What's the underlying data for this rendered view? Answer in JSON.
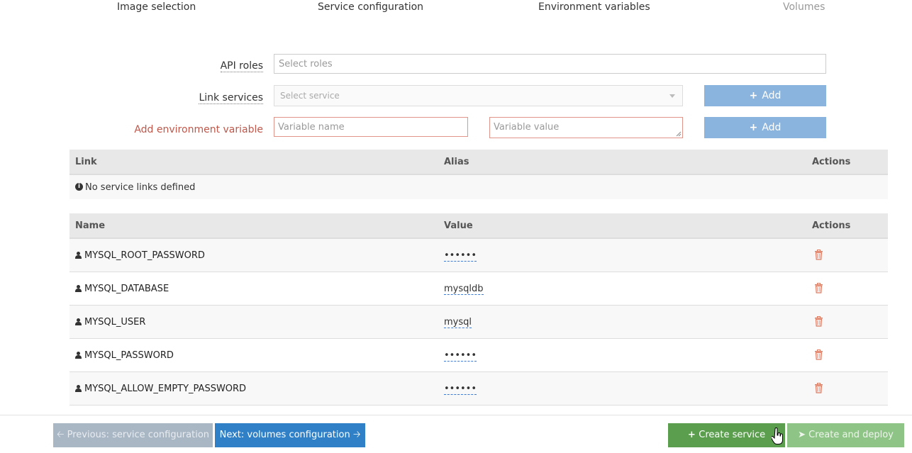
{
  "steps": [
    {
      "label": "Image selection"
    },
    {
      "label": "Service configuration"
    },
    {
      "label": "Environment variables"
    },
    {
      "label": "Volumes"
    }
  ],
  "form": {
    "api_roles_label": "API roles",
    "api_roles_placeholder": "Select roles",
    "link_services_label": "Link services",
    "link_services_placeholder": "Select service",
    "link_add_label": "Add",
    "env_label": "Add environment variable",
    "env_name_placeholder": "Variable name",
    "env_value_placeholder": "Variable value",
    "env_add_label": "Add"
  },
  "links_table": {
    "headers": {
      "link": "Link",
      "alias": "Alias",
      "actions": "Actions"
    },
    "empty_message": "No service links defined"
  },
  "env_table": {
    "headers": {
      "name": "Name",
      "value": "Value",
      "actions": "Actions"
    },
    "rows": [
      {
        "name": "MYSQL_ROOT_PASSWORD",
        "value": "••••••"
      },
      {
        "name": "MYSQL_DATABASE",
        "value": "mysqldb"
      },
      {
        "name": "MYSQL_USER",
        "value": "mysql"
      },
      {
        "name": "MYSQL_PASSWORD",
        "value": "••••••"
      },
      {
        "name": "MYSQL_ALLOW_EMPTY_PASSWORD",
        "value": "••••••"
      }
    ]
  },
  "footer": {
    "prev_label": "Previous: service configuration",
    "next_label": "Next: volumes configuration",
    "create_label": "Create service",
    "deploy_label": "Create and deploy"
  },
  "colors": {
    "primary": "#2f80c7",
    "success": "#5a9e4e",
    "add_button": "#8ab4de",
    "danger": "#e07a5f",
    "error_label": "#c0574a"
  }
}
